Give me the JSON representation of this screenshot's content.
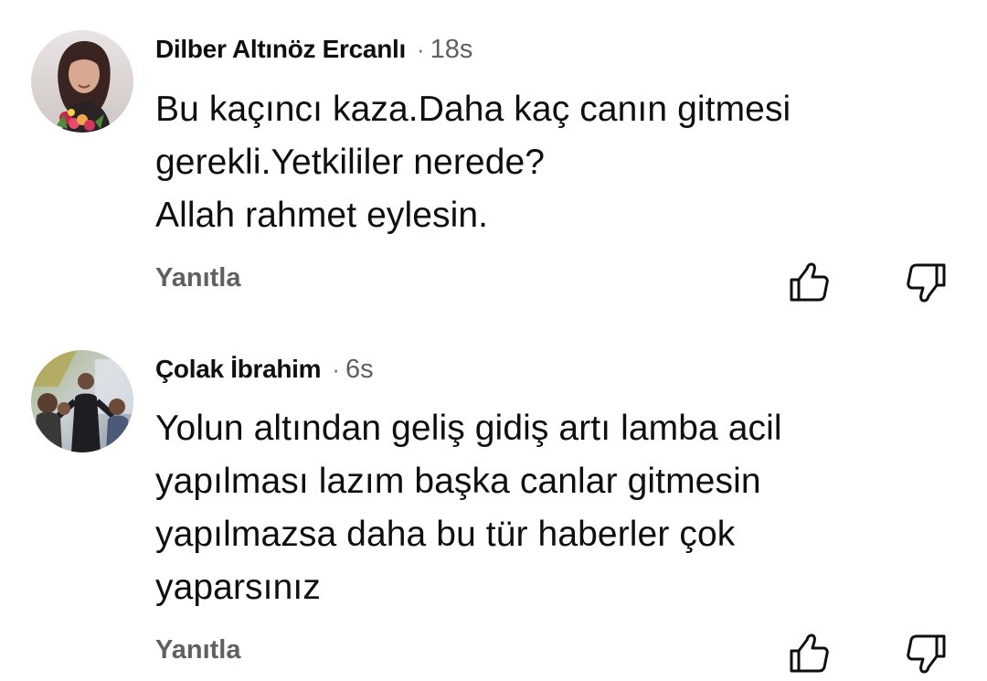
{
  "comments": [
    {
      "author": "Dilber Altınöz Ercanlı",
      "separator": "·",
      "time": "18s",
      "lines": [
        "Bu kaçıncı kaza.Daha kaç canın gitmesi",
        "gerekli.Yetkililer nerede?",
        "Allah rahmet eylesin."
      ],
      "reply_label": "Yanıtla",
      "like_icon": "thumbs-up-icon",
      "dislike_icon": "thumbs-down-icon"
    },
    {
      "author": "Çolak İbrahim",
      "separator": "·",
      "time": "6s",
      "lines": [
        "Yolun altından geliş gidiş artı lamba acil",
        "yapılması lazım başka canlar gitmesin",
        "yapılmazsa daha bu tür haberler çok",
        "yaparsınız"
      ],
      "reply_label": "Yanıtla",
      "like_icon": "thumbs-up-icon",
      "dislike_icon": "thumbs-down-icon"
    }
  ],
  "colors": {
    "author": "#0f0f0f",
    "meta": "#606060",
    "icon": "#0f0f0f"
  }
}
